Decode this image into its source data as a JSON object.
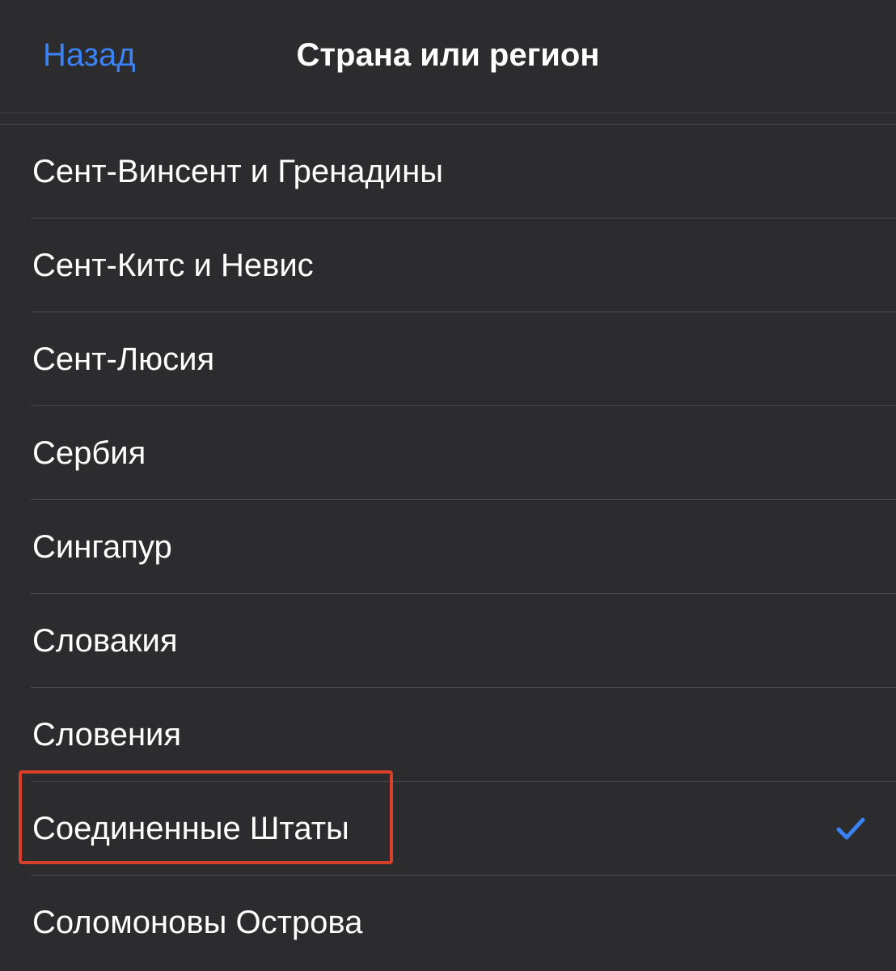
{
  "nav": {
    "back_label": "Назад",
    "title": "Страна или регион"
  },
  "list": {
    "items": [
      {
        "label": "Сент-Винсент и Гренадины",
        "selected": false
      },
      {
        "label": "Сент-Китс и Невис",
        "selected": false
      },
      {
        "label": "Сент-Люсия",
        "selected": false
      },
      {
        "label": "Сербия",
        "selected": false
      },
      {
        "label": "Сингапур",
        "selected": false
      },
      {
        "label": "Словакия",
        "selected": false
      },
      {
        "label": "Словения",
        "selected": false
      },
      {
        "label": "Соединенные Штаты",
        "selected": true
      },
      {
        "label": "Соломоновы Острова",
        "selected": false
      }
    ]
  },
  "colors": {
    "background": "#2c2c2e",
    "accent": "#3b82f6",
    "highlight": "#d9402a",
    "separator": "#4a4a4e",
    "text": "#ffffff"
  },
  "icons": {
    "selected_marker": "checkmark-icon"
  }
}
